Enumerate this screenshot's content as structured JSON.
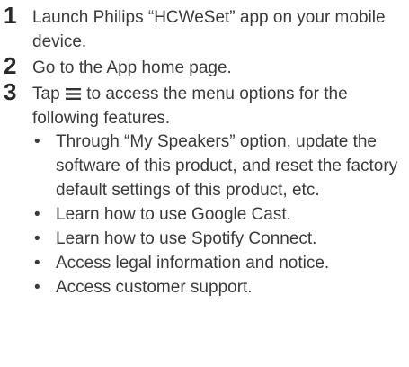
{
  "steps": [
    {
      "number": "1",
      "text": "Launch Philips “HCWeSet” app on your mobile device."
    },
    {
      "number": "2",
      "text": "Go to the App home page."
    },
    {
      "number": "3",
      "text_before_icon": "Tap ",
      "icon": "menu-icon",
      "text_after_icon": " to access the menu options for the following features."
    }
  ],
  "bullet_symbol": "•",
  "features": [
    "Through “My Speakers” option, update the software of this product, and reset the factory default settings of this product, etc.",
    "Learn how to use Google Cast.",
    "Learn how to use Spotify Connect.",
    "Access legal information and notice.",
    "Access customer support."
  ]
}
